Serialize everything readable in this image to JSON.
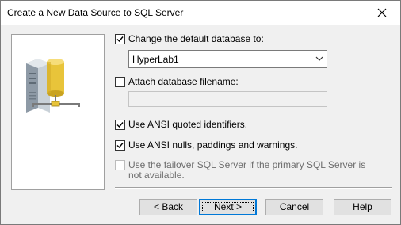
{
  "window": {
    "title": "Create a New Data Source to SQL Server"
  },
  "options": {
    "change_default_db": {
      "label": "Change the default database to:",
      "checked": true
    },
    "database_select": {
      "value": "HyperLab1"
    },
    "attach_filename": {
      "label": "Attach database filename:",
      "checked": false
    },
    "attach_filename_field": {
      "value": ""
    },
    "ansi_quoted": {
      "label": "Use ANSI quoted identifiers.",
      "checked": true
    },
    "ansi_nulls": {
      "label": "Use ANSI nulls, paddings and warnings.",
      "checked": true
    },
    "failover": {
      "label": "Use the failover SQL Server if the primary SQL Server is not available.",
      "checked": false,
      "disabled": true
    }
  },
  "buttons": {
    "back": "< Back",
    "next": "Next >",
    "cancel": "Cancel",
    "help": "Help"
  },
  "icons": {
    "close": "close-icon",
    "server": "database-server-icon",
    "dropdown": "chevron-down-icon",
    "check": "check-icon"
  },
  "colors": {
    "focus_border": "#0078d7",
    "button_face": "#e1e1e1",
    "dialog_bg": "#f0f0f0",
    "database_yellow": "#e8c43a"
  }
}
